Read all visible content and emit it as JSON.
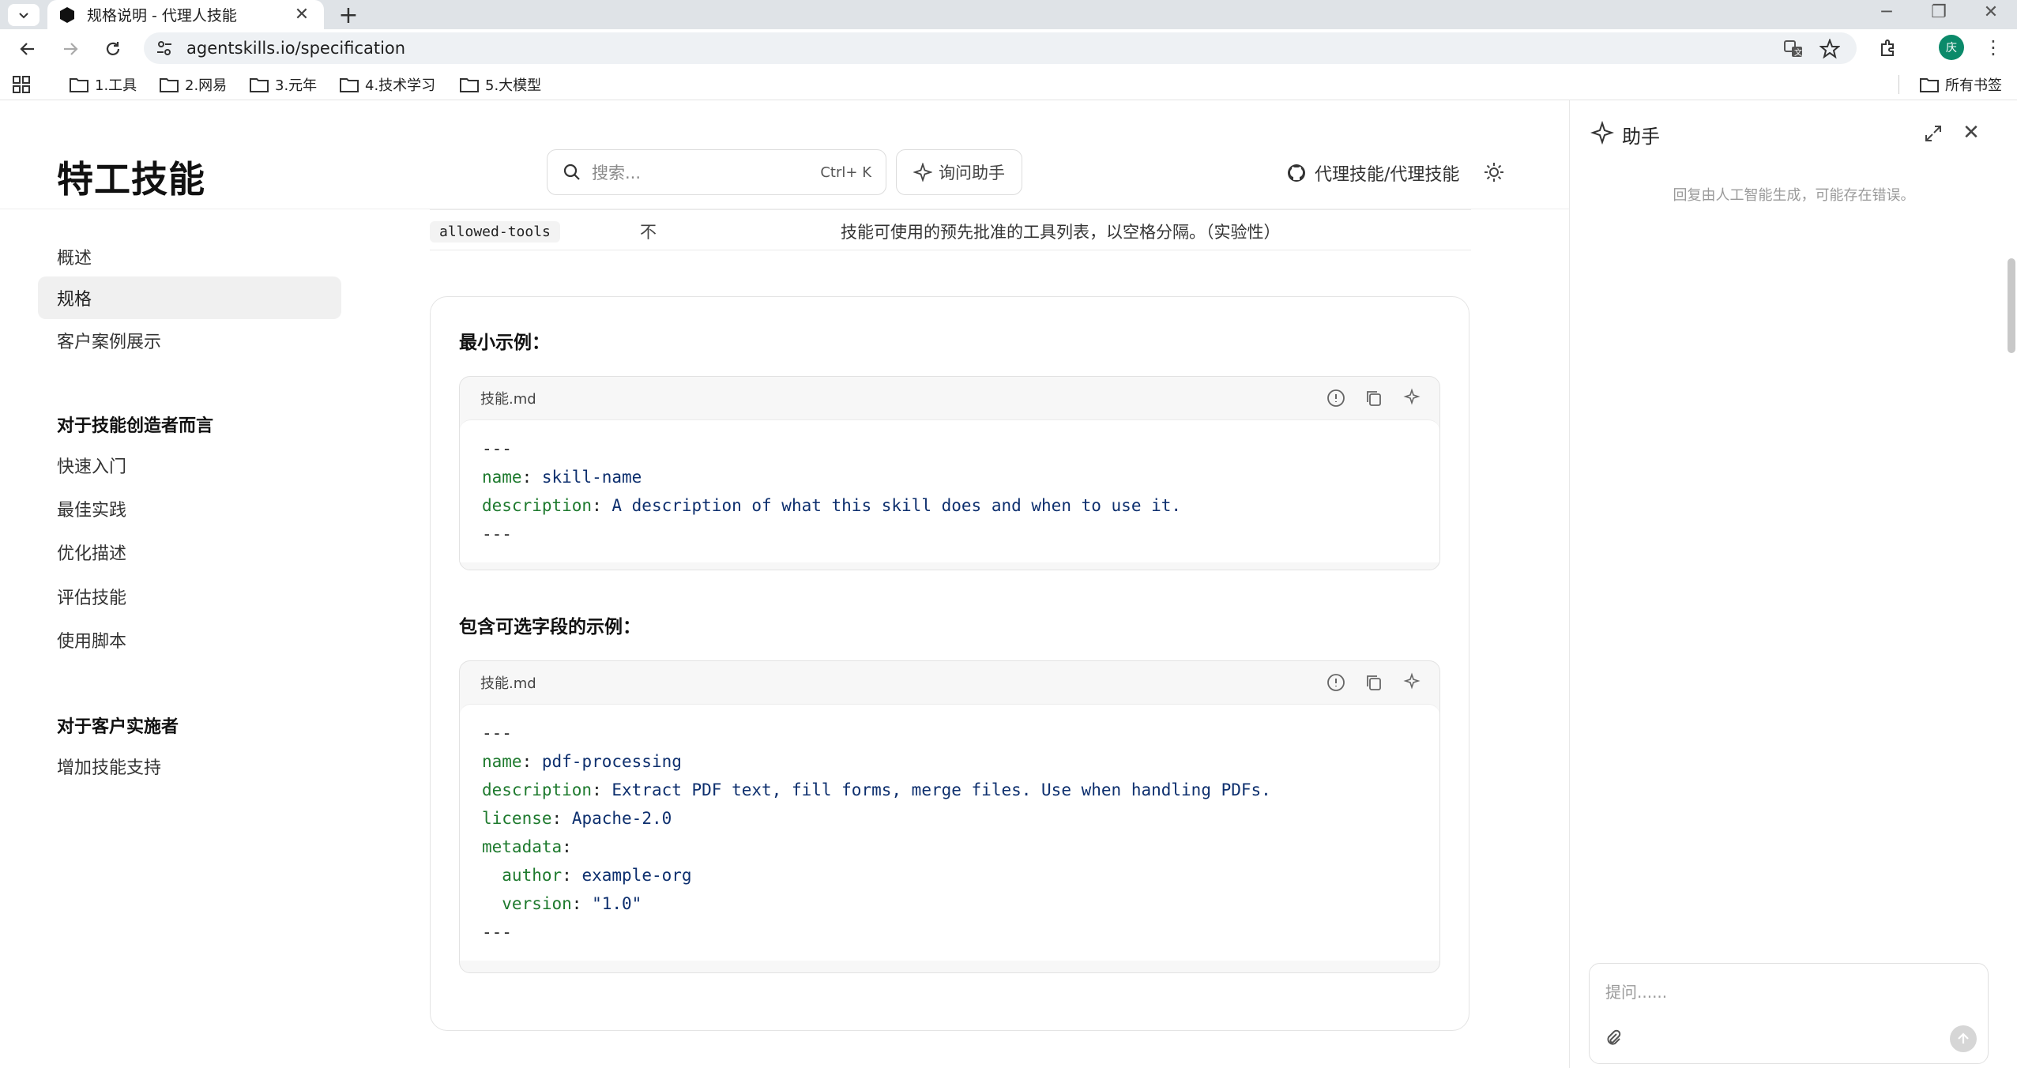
{
  "browser": {
    "tab_title": "规格说明 - 代理人技能",
    "url": "agentskills.io/specification",
    "avatar_initial": "庆",
    "bookmarks": [
      "1.工具",
      "2.网易",
      "3.元年",
      "4.技术学习",
      "5.大模型"
    ],
    "all_bookmarks": "所有书签"
  },
  "site": {
    "logo": "特工技能",
    "search_placeholder": "搜索...",
    "search_shortcut": "Ctrl+ K",
    "ask_assistant": "询问助手",
    "repo_link": "代理技能/代理技能"
  },
  "sidebar": {
    "items": [
      "概述",
      "规格",
      "客户案例展示"
    ],
    "active_index": 1,
    "section1_title": "对于技能创造者而言",
    "section1_items": [
      "快速入门",
      "最佳实践",
      "优化描述",
      "评估技能",
      "使用脚本"
    ],
    "section2_title": "对于客户实施者",
    "section2_items": [
      "增加技能支持"
    ]
  },
  "content": {
    "row": {
      "field": "allowed-tools",
      "required": "不",
      "description": "技能可使用的预先批准的工具列表，以空格分隔。（实验性）"
    },
    "example1": {
      "title": "最小示例：",
      "filename": "技能.md",
      "lines": [
        {
          "k": "---",
          "v": ""
        },
        {
          "k": "name",
          "v": " skill-name"
        },
        {
          "k": "description",
          "v": " A description of what this skill does and when to use it."
        },
        {
          "k": "---",
          "v": ""
        }
      ]
    },
    "example2": {
      "title": "包含可选字段的示例：",
      "filename": "技能.md",
      "lines": [
        {
          "k": "---",
          "v": ""
        },
        {
          "k": "name",
          "v": " pdf-processing"
        },
        {
          "k": "description",
          "v": " Extract PDF text, fill forms, merge files. Use when handling PDFs."
        },
        {
          "k": "license",
          "v": " Apache-2.0"
        },
        {
          "k": "metadata",
          "v": ""
        },
        {
          "k": "  author",
          "v": " example-org"
        },
        {
          "k": "  version",
          "v": " \"1.0\""
        },
        {
          "k": "---",
          "v": ""
        }
      ]
    }
  },
  "assistant": {
    "title": "助手",
    "note": "回复由人工智能生成，可能存在错误。",
    "input_placeholder": "提问......"
  },
  "colors": {
    "code_key": "#1e7a2e",
    "code_value": "#0d2f6e",
    "avatar_bg": "#0b8a6a"
  }
}
